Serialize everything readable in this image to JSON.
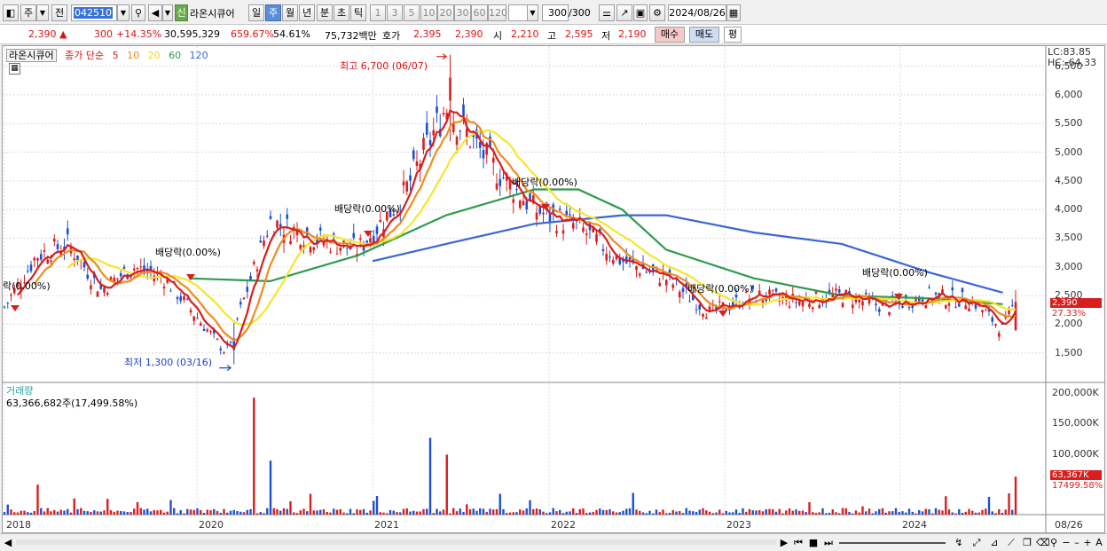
{
  "toolbar": {
    "period_label": "주",
    "prev_label": "전",
    "stock_code": "042510",
    "new_badge": "신",
    "stock_name": "라온시큐어",
    "intervals": [
      "일",
      "주",
      "월",
      "년",
      "분",
      "초",
      "틱"
    ],
    "active_interval": "주",
    "numbers": [
      "1",
      "3",
      "5",
      "10",
      "20",
      "30",
      "60",
      "120"
    ],
    "count": "300",
    "count_total": "/300",
    "date": "2024/08/26"
  },
  "quote": {
    "price": "2,390",
    "change": "300",
    "change_pct": "+14.35%",
    "volume": "30,595,329",
    "vol_ratio": "659.67%",
    "strength": "54.61%",
    "amount": "75,732백만",
    "bid_label": "호가",
    "ask": "2,395",
    "bid": "2,390",
    "open_label": "시",
    "open": "2,210",
    "high_label": "고",
    "high": "2,595",
    "low_label": "저",
    "low": "2,190",
    "buy_label": "매수",
    "sell_label": "매도",
    "avg_label": "평"
  },
  "legend": {
    "name": "라온시큐어",
    "close_label": "종가 단순",
    "ma": [
      "5",
      "10",
      "20",
      "60",
      "120"
    ],
    "lc": "LC:83.85",
    "hc": "HC:-64.33"
  },
  "annotations": {
    "high": "최고 6,700 (06/07)",
    "low": "최저 1,300 (03/16)",
    "dividend_1": "락(0.00%)",
    "dividend_2": "배당락(0.00%)",
    "dividend_3": "배당락(0.00%)",
    "dividend_4": "배당락(0.00%)",
    "dividend_5": "배당락(0.00%)",
    "dividend_6": "배당락(0.00%)"
  },
  "price_axis": [
    "6,500",
    "6,000",
    "5,500",
    "5,000",
    "4,500",
    "4,000",
    "3,500",
    "3,000",
    "2,500",
    "2,000",
    "1,500"
  ],
  "price_tag": {
    "price": "2,390",
    "pct": "27.33%"
  },
  "volume_panel": {
    "title": "거래량",
    "value": "63,366,682주(17,499.58%)",
    "axis": [
      "200,000K",
      "150,000K",
      "100,000K"
    ],
    "tag": "63,367K",
    "tag_pct": "17499.58%"
  },
  "x_axis": [
    "2018",
    "2020",
    "2021",
    "2022",
    "2023",
    "2024"
  ],
  "x_axis_end": "08/26",
  "colors": {
    "up": "#d91e1e",
    "down": "#1f4fcf",
    "ma5": "#d91e1e",
    "ma10": "#f08c1e",
    "ma20": "#f5e62e",
    "ma60": "#2e9a4e",
    "ma120": "#3a66d8"
  },
  "chart_data": {
    "type": "candlestick",
    "timeframe": "weekly",
    "x_range": [
      "2018",
      "2024/08/26"
    ],
    "ylim": [
      1300,
      6700
    ],
    "price_ticks": [
      1500,
      2000,
      2500,
      3000,
      3500,
      4000,
      4500,
      5000,
      5500,
      6000,
      6500
    ],
    "close_points": [
      {
        "x": "2018-01",
        "y": 2300
      },
      {
        "x": "2018-05",
        "y": 3200
      },
      {
        "x": "2018-09",
        "y": 3400
      },
      {
        "x": "2019-01",
        "y": 2600
      },
      {
        "x": "2019-05",
        "y": 3000
      },
      {
        "x": "2019-09",
        "y": 2800
      },
      {
        "x": "2020-03",
        "y": 1500
      },
      {
        "x": "2020-06",
        "y": 3800
      },
      {
        "x": "2020-09",
        "y": 3500
      },
      {
        "x": "2020-12",
        "y": 3300
      },
      {
        "x": "2021-03",
        "y": 4200
      },
      {
        "x": "2021-06",
        "y": 5800
      },
      {
        "x": "2021-09",
        "y": 4800
      },
      {
        "x": "2021-12",
        "y": 4000
      },
      {
        "x": "2022-03",
        "y": 3700
      },
      {
        "x": "2022-06",
        "y": 3100
      },
      {
        "x": "2022-09",
        "y": 2800
      },
      {
        "x": "2022-12",
        "y": 2200
      },
      {
        "x": "2023-03",
        "y": 2500
      },
      {
        "x": "2023-06",
        "y": 2400
      },
      {
        "x": "2023-09",
        "y": 2500
      },
      {
        "x": "2023-12",
        "y": 2300
      },
      {
        "x": "2024-03",
        "y": 2500
      },
      {
        "x": "2024-06",
        "y": 2400
      },
      {
        "x": "2024-08",
        "y": 1900
      },
      {
        "x": "2024-08-26",
        "y": 2390
      }
    ],
    "ma120_points": [
      {
        "x": "2021-01",
        "y": 3100
      },
      {
        "x": "2021-06",
        "y": 3400
      },
      {
        "x": "2021-12",
        "y": 3750
      },
      {
        "x": "2022-06",
        "y": 3900
      },
      {
        "x": "2022-09",
        "y": 3900
      },
      {
        "x": "2023-03",
        "y": 3600
      },
      {
        "x": "2023-09",
        "y": 3400
      },
      {
        "x": "2024-03",
        "y": 2900
      },
      {
        "x": "2024-08",
        "y": 2550
      }
    ],
    "ma60_points": [
      {
        "x": "2019-12",
        "y": 2800
      },
      {
        "x": "2020-06",
        "y": 2750
      },
      {
        "x": "2020-12",
        "y": 3200
      },
      {
        "x": "2021-06",
        "y": 3900
      },
      {
        "x": "2021-12",
        "y": 4350
      },
      {
        "x": "2022-03",
        "y": 4350
      },
      {
        "x": "2022-06",
        "y": 4000
      },
      {
        "x": "2022-09",
        "y": 3300
      },
      {
        "x": "2023-03",
        "y": 2800
      },
      {
        "x": "2023-09",
        "y": 2500
      },
      {
        "x": "2024-03",
        "y": 2450
      },
      {
        "x": "2024-08",
        "y": 2350
      }
    ],
    "volume_ylim": [
      0,
      200000
    ],
    "volume_unit": "K",
    "volume_spikes": [
      {
        "x": "2018-05",
        "value": 50000
      },
      {
        "x": "2020-05",
        "value": 195000
      },
      {
        "x": "2020-06",
        "value": 90000
      },
      {
        "x": "2021-05",
        "value": 128000
      },
      {
        "x": "2021-06",
        "value": 100000
      },
      {
        "x": "2024-08-26",
        "value": 63367
      }
    ]
  }
}
